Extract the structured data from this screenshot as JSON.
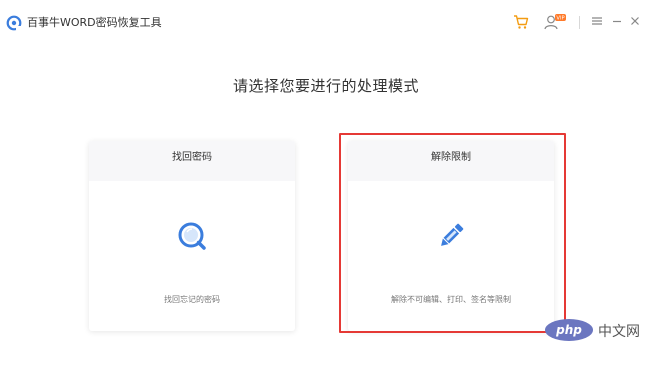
{
  "window": {
    "title": "百事牛WORD密码恢复工具",
    "icons": [
      "app-logo-icon",
      "cart-icon",
      "user-vip-icon",
      "menu-icon",
      "minimize-icon",
      "close-icon"
    ],
    "user_badge": "VIP"
  },
  "main": {
    "heading": "请选择您要进行的处理模式",
    "modes": [
      {
        "title": "找回密码",
        "description": "找回忘记的密码",
        "icon": "search-icon",
        "selected": false
      },
      {
        "title": "解除限制",
        "description": "解除不可编辑、打印、签名等限制",
        "icon": "pencil-icon",
        "selected": true
      }
    ]
  },
  "watermark": {
    "logo": "php",
    "text": "中文网"
  },
  "colors": {
    "accent": "#3b7ddd",
    "highlight": "#e53935",
    "cart": "#f39c12",
    "badge": "#ff7a2a"
  }
}
